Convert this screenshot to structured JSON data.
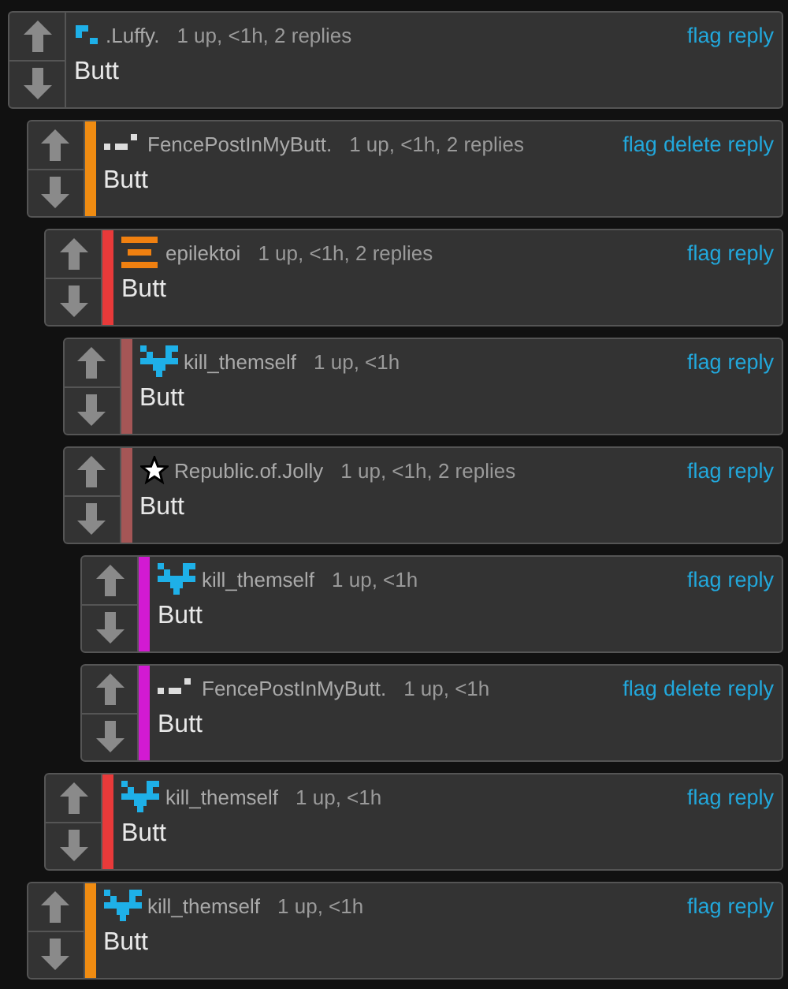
{
  "comments": [
    {
      "kind": "blocks",
      "username": ".Luffy.",
      "meta": "1 up, <1h, 2 replies",
      "actions": [
        "flag",
        "reply"
      ],
      "text": "Butt",
      "children": [
        {
          "kind": "dashes",
          "username": "FencePostInMyButt.",
          "meta": "1 up, <1h, 2 replies",
          "actions": [
            "flag",
            "delete",
            "reply"
          ],
          "text": "Butt",
          "children": [
            {
              "kind": "bars",
              "username": "epilektoi",
              "meta": "1 up, <1h, 2 replies",
              "actions": [
                "flag",
                "reply"
              ],
              "text": "Butt",
              "children": [
                {
                  "kind": "heart",
                  "username": "kill_themself",
                  "meta": "1 up, <1h",
                  "actions": [
                    "flag",
                    "reply"
                  ],
                  "text": "Butt"
                },
                {
                  "kind": "star",
                  "username": "Republic.of.Jolly",
                  "meta": "1 up, <1h, 2 replies",
                  "actions": [
                    "flag",
                    "reply"
                  ],
                  "text": "Butt",
                  "children": [
                    {
                      "kind": "heart",
                      "username": "kill_themself",
                      "meta": "1 up, <1h",
                      "actions": [
                        "flag",
                        "reply"
                      ],
                      "text": "Butt"
                    },
                    {
                      "kind": "dashes",
                      "username": "FencePostInMyButt.",
                      "meta": "1 up, <1h",
                      "actions": [
                        "flag",
                        "delete",
                        "reply"
                      ],
                      "text": "Butt"
                    }
                  ]
                }
              ]
            },
            {
              "kind": "heart",
              "username": "kill_themself",
              "meta": "1 up, <1h",
              "actions": [
                "flag",
                "reply"
              ],
              "text": "Butt"
            }
          ]
        },
        {
          "kind": "heart",
          "username": "kill_themself",
          "meta": "1 up, <1h",
          "actions": [
            "flag",
            "reply"
          ],
          "text": "Butt"
        }
      ]
    }
  ]
}
